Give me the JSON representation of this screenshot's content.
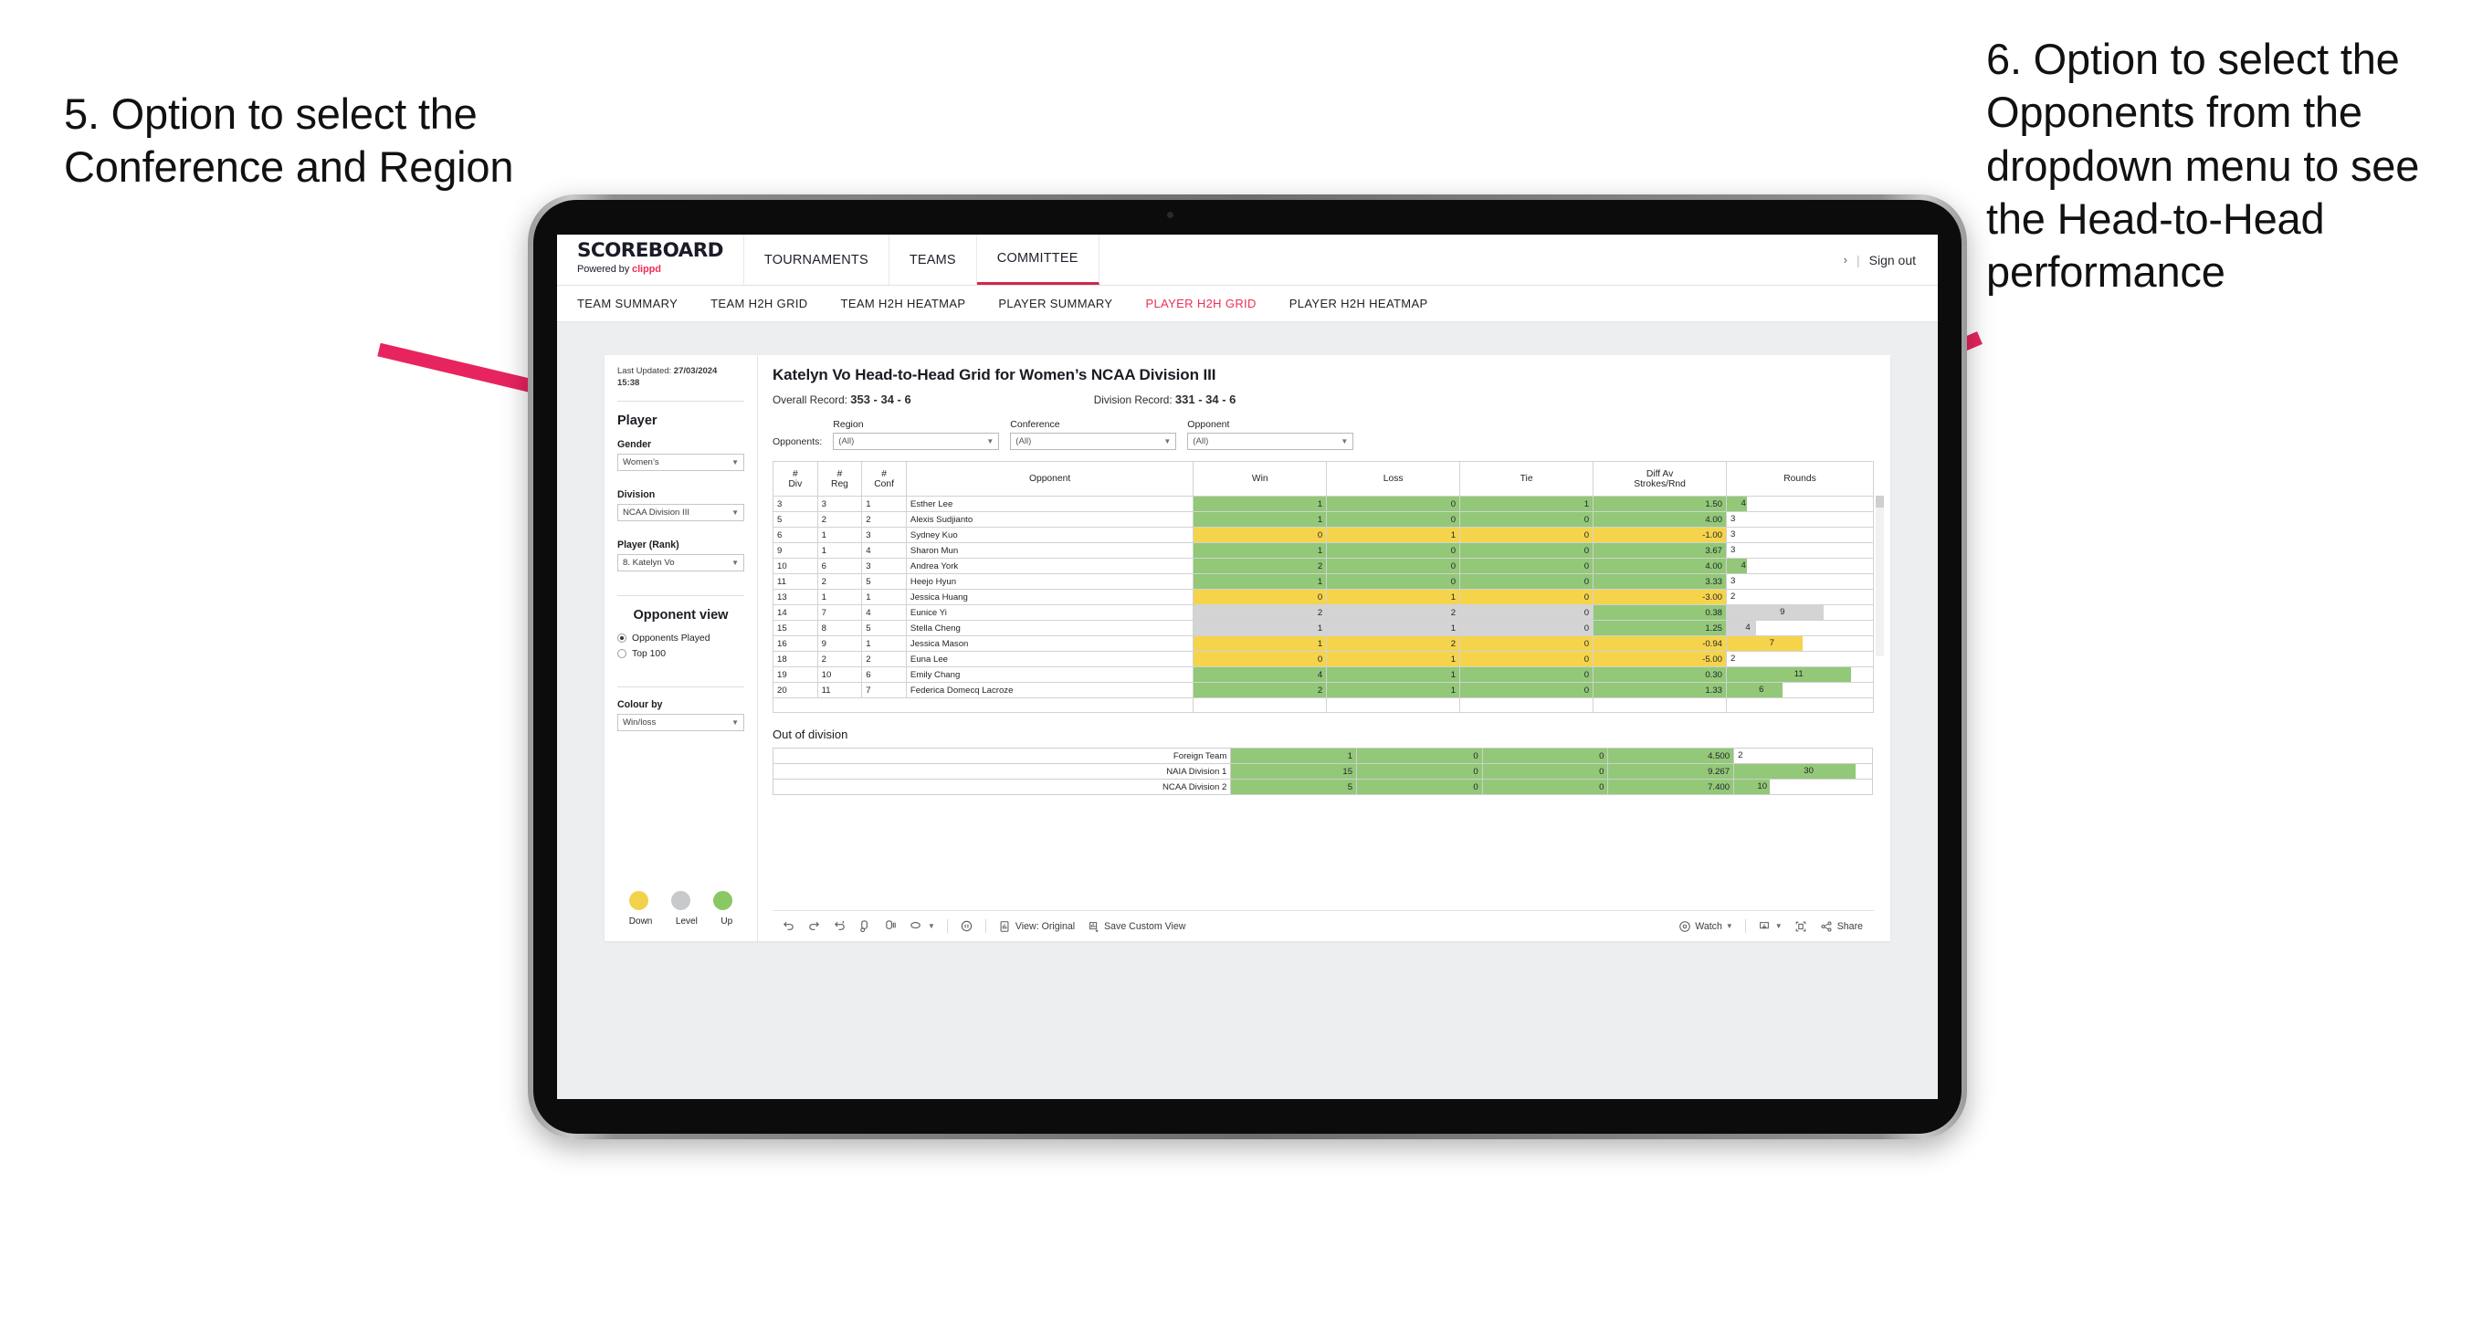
{
  "annotations": {
    "left": "5. Option to select the Conference and Region",
    "right": "6. Option to select the Opponents from the dropdown menu to see the Head-to-Head performance",
    "arrow_color": "#e8245f"
  },
  "app": {
    "brand": {
      "title": "SCOREBOARD",
      "powered_prefix": "Powered by ",
      "powered_brand": "clippd"
    },
    "topnav": [
      {
        "label": "TOURNAMENTS",
        "active": false
      },
      {
        "label": "TEAMS",
        "active": false
      },
      {
        "label": "COMMITTEE",
        "active": true
      }
    ],
    "topbar_right": {
      "chevron": "›",
      "separator": "|",
      "sign_out": "Sign out"
    },
    "subnav": [
      {
        "label": "TEAM SUMMARY",
        "active": false
      },
      {
        "label": "TEAM H2H GRID",
        "active": false
      },
      {
        "label": "TEAM H2H HEATMAP",
        "active": false
      },
      {
        "label": "PLAYER SUMMARY",
        "active": false
      },
      {
        "label": "PLAYER H2H GRID",
        "active": true
      },
      {
        "label": "PLAYER H2H HEATMAP",
        "active": false
      }
    ],
    "accent": "#ef2d56"
  },
  "sidebar": {
    "last_updated_label": "Last Updated: ",
    "last_updated_value": "27/03/2024",
    "last_updated_time": "15:38",
    "player_heading": "Player",
    "gender": {
      "label": "Gender",
      "value": "Women’s"
    },
    "division": {
      "label": "Division",
      "value": "NCAA Division III"
    },
    "player_rank": {
      "label": "Player (Rank)",
      "value": "8. Katelyn Vo"
    },
    "opponent_view": {
      "heading": "Opponent view",
      "options": [
        {
          "label": "Opponents Played",
          "selected": true
        },
        {
          "label": "Top 100",
          "selected": false
        }
      ]
    },
    "colour_by": {
      "label": "Colour by",
      "value": "Win/loss"
    },
    "legend": {
      "items": [
        {
          "label": "Down",
          "color": "#f2d24b"
        },
        {
          "label": "Level",
          "color": "#c7c9cc"
        },
        {
          "label": "Up",
          "color": "#8ac765"
        }
      ]
    }
  },
  "main": {
    "title": "Katelyn Vo Head-to-Head Grid for Women’s NCAA Division III",
    "overall_record_label": "Overall Record: ",
    "overall_record_value": "353 -  34 - 6",
    "division_record_label": "Division Record: ",
    "division_record_value": "331 -  34 - 6",
    "filters_label": "Opponents:",
    "filters": [
      {
        "label": "Region",
        "value": "(All)"
      },
      {
        "label": "Conference",
        "value": "(All)"
      },
      {
        "label": "Opponent",
        "value": "(All)"
      }
    ],
    "grid_headers": [
      "#\nDiv",
      "#\nReg",
      "#\nConf",
      "Opponent",
      "Win",
      "Loss",
      "Tie",
      "Diff Av\nStrokes/Rnd",
      "Rounds"
    ],
    "grid_headers_flat": {
      "div": [
        "#",
        "Div"
      ],
      "reg": [
        "#",
        "Reg"
      ],
      "conf": [
        "#",
        "Conf"
      ],
      "opponent": "Opponent",
      "win": "Win",
      "loss": "Loss",
      "tie": "Tie",
      "diff": [
        "Diff Av",
        "Strokes/Rnd"
      ],
      "rounds": "Rounds"
    },
    "grid_rows": [
      {
        "div": "3",
        "reg": "3",
        "conf": "1",
        "opponent": "Esther Lee",
        "win": "1",
        "loss": "0",
        "tie": "1",
        "diff": "1.50",
        "rounds": "4",
        "color": "g",
        "bar_pct": 14
      },
      {
        "div": "5",
        "reg": "2",
        "conf": "2",
        "opponent": "Alexis Sudjianto",
        "win": "1",
        "loss": "0",
        "tie": "0",
        "diff": "4.00",
        "rounds": "3",
        "color": "g",
        "bar_pct": 0
      },
      {
        "div": "6",
        "reg": "1",
        "conf": "3",
        "opponent": "Sydney Kuo",
        "win": "0",
        "loss": "1",
        "tie": "0",
        "diff": "-1.00",
        "rounds": "3",
        "color": "y",
        "bar_pct": 0
      },
      {
        "div": "9",
        "reg": "1",
        "conf": "4",
        "opponent": "Sharon Mun",
        "win": "1",
        "loss": "0",
        "tie": "0",
        "diff": "3.67",
        "rounds": "3",
        "color": "g",
        "bar_pct": 0
      },
      {
        "div": "10",
        "reg": "6",
        "conf": "3",
        "opponent": "Andrea York",
        "win": "2",
        "loss": "0",
        "tie": "0",
        "diff": "4.00",
        "rounds": "4",
        "color": "g",
        "bar_pct": 14
      },
      {
        "div": "11",
        "reg": "2",
        "conf": "5",
        "opponent": "Heejo Hyun",
        "win": "1",
        "loss": "0",
        "tie": "0",
        "diff": "3.33",
        "rounds": "3",
        "color": "g",
        "bar_pct": 0
      },
      {
        "div": "13",
        "reg": "1",
        "conf": "1",
        "opponent": "Jessica Huang",
        "win": "0",
        "loss": "1",
        "tie": "0",
        "diff": "-3.00",
        "rounds": "2",
        "color": "y",
        "bar_pct": 0
      },
      {
        "div": "14",
        "reg": "7",
        "conf": "4",
        "opponent": "Eunice Yi",
        "win": "2",
        "loss": "2",
        "tie": "0",
        "diff": "0.38",
        "rounds": "9",
        "color": "n",
        "bar_pct": 66,
        "diff_color": "g"
      },
      {
        "div": "15",
        "reg": "8",
        "conf": "5",
        "opponent": "Stella Cheng",
        "win": "1",
        "loss": "1",
        "tie": "0",
        "diff": "1.25",
        "rounds": "4",
        "color": "n",
        "bar_pct": 20,
        "diff_color": "g"
      },
      {
        "div": "16",
        "reg": "9",
        "conf": "1",
        "opponent": "Jessica Mason",
        "win": "1",
        "loss": "2",
        "tie": "0",
        "diff": "-0.94",
        "rounds": "7",
        "color": "y",
        "bar_pct": 52
      },
      {
        "div": "18",
        "reg": "2",
        "conf": "2",
        "opponent": "Euna Lee",
        "win": "0",
        "loss": "1",
        "tie": "0",
        "diff": "-5.00",
        "rounds": "2",
        "color": "y",
        "bar_pct": 0
      },
      {
        "div": "19",
        "reg": "10",
        "conf": "6",
        "opponent": "Emily Chang",
        "win": "4",
        "loss": "1",
        "tie": "0",
        "diff": "0.30",
        "rounds": "11",
        "color": "g",
        "bar_pct": 85
      },
      {
        "div": "20",
        "reg": "11",
        "conf": "7",
        "opponent": "Federica Domecq Lacroze",
        "win": "2",
        "loss": "1",
        "tie": "0",
        "diff": "1.33",
        "rounds": "6",
        "color": "g",
        "bar_pct": 38
      }
    ],
    "out_of_division": {
      "title": "Out of division",
      "rows": [
        {
          "name": "Foreign Team",
          "win": "1",
          "loss": "0",
          "tie": "0",
          "diff": "4.500",
          "rounds": "2",
          "color": "g",
          "bar_pct": 0
        },
        {
          "name": "NAIA Division 1",
          "win": "15",
          "loss": "0",
          "tie": "0",
          "diff": "9.267",
          "rounds": "30",
          "color": "g",
          "bar_pct": 88
        },
        {
          "name": "NCAA Division 2",
          "win": "5",
          "loss": "0",
          "tie": "0",
          "diff": "7.400",
          "rounds": "10",
          "color": "g",
          "bar_pct": 26
        }
      ]
    }
  },
  "toolbar": {
    "view_label": "View: Original",
    "save_label": "Save Custom View",
    "watch_label": "Watch",
    "share_label": "Share"
  },
  "colors": {
    "green": "#92c878",
    "yellow": "#f5d44c",
    "grey": "#d4d4d4",
    "accent": "#ef2d56"
  }
}
